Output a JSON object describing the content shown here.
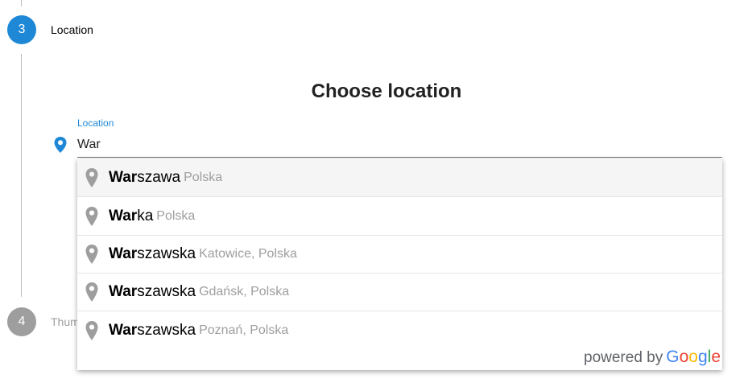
{
  "stepper": {
    "steps": [
      {
        "number": "3",
        "label": "Location"
      },
      {
        "number": "4",
        "label": "Thum"
      }
    ]
  },
  "form": {
    "title": "Choose location",
    "location_label": "Location",
    "location_value": "War"
  },
  "autocomplete": {
    "items": [
      {
        "match": "War",
        "rest": "szawa",
        "secondary": "Polska"
      },
      {
        "match": "War",
        "rest": "ka",
        "secondary": "Polska"
      },
      {
        "match": "War",
        "rest": "szawska",
        "secondary": "Katowice, Polska"
      },
      {
        "match": "War",
        "rest": "szawska",
        "secondary": "Gdańsk, Polska"
      },
      {
        "match": "War",
        "rest": "szawska",
        "secondary": "Poznań, Polska"
      }
    ],
    "powered_by": "powered by",
    "brand": [
      "G",
      "o",
      "o",
      "g",
      "l",
      "e"
    ],
    "brand_colors": [
      "#4285F4",
      "#EA4335",
      "#FBBC05",
      "#4285F4",
      "#34A853",
      "#EA4335"
    ]
  },
  "colors": {
    "accent": "#1e88d6",
    "inactive_step": "#9e9e9e",
    "pin_gray": "#9e9e9e"
  }
}
